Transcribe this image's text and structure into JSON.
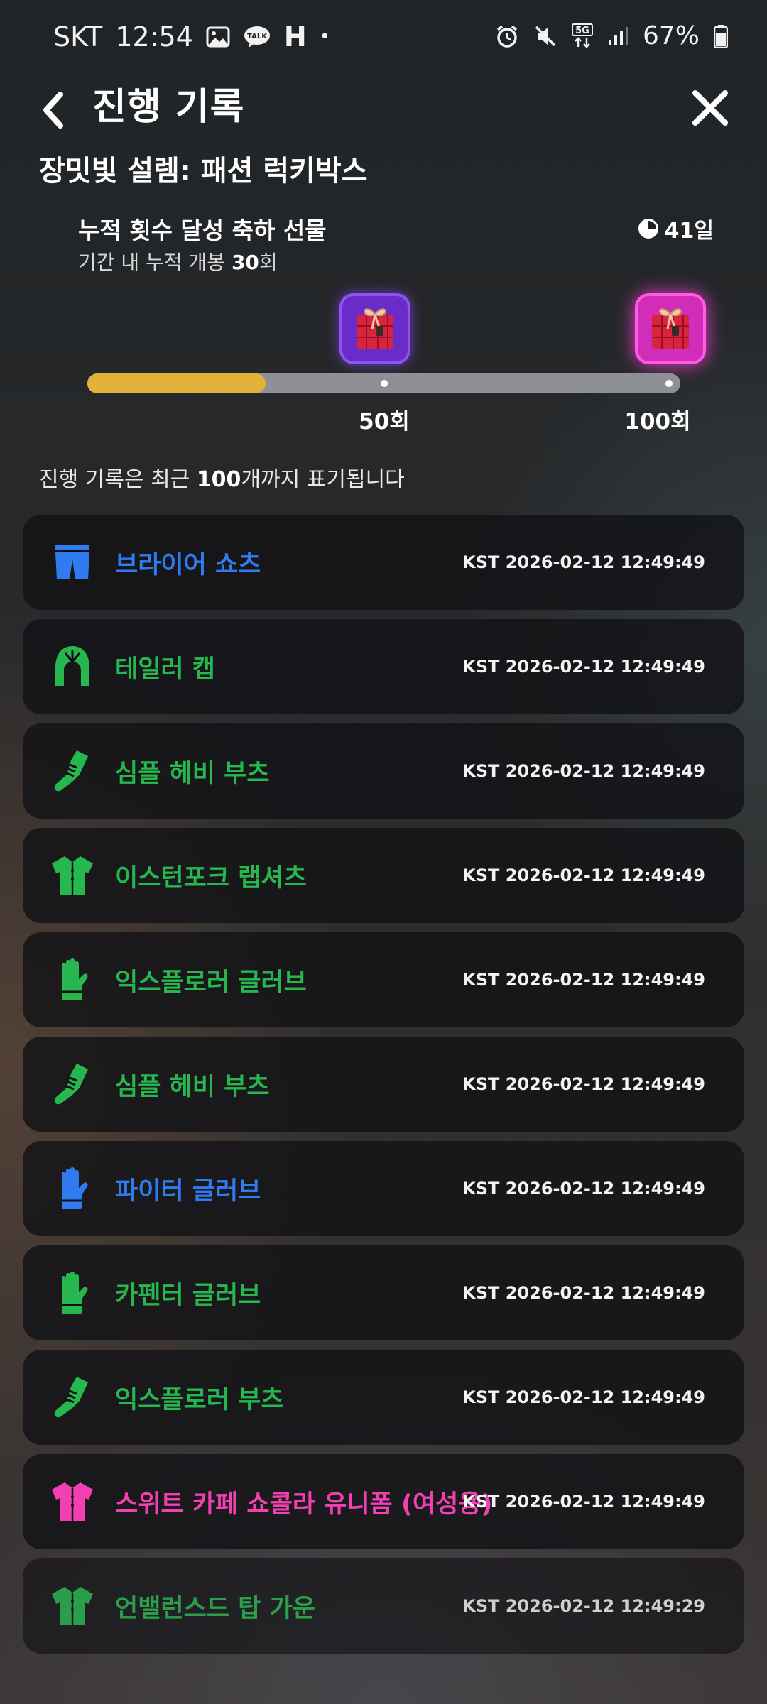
{
  "status": {
    "carrier": "SKT",
    "time": "12:54",
    "talk_badge": "TALK",
    "h_label": "H",
    "dot": "•",
    "network": "5G",
    "battery": "67%"
  },
  "header": {
    "title": "진행 기록"
  },
  "event": {
    "title": "장밋빛 설렘: 패션 럭키박스"
  },
  "reward": {
    "name": "누적 횟수 달성 축하 선물",
    "desc_prefix": "기간 내 누적 개봉 ",
    "desc_count": "30",
    "desc_suffix": "회",
    "days_left": "41일"
  },
  "progress": {
    "current": 30,
    "max": 100,
    "fill_fraction": 0.3,
    "milestones": [
      {
        "value": 50,
        "label": "50회"
      },
      {
        "value": 100,
        "label": "100회"
      }
    ]
  },
  "history_note": {
    "prefix": "진행 기록은 최근 ",
    "count": "100",
    "suffix": "개까지 표기됩니다"
  },
  "colors": {
    "blue": "#2f7cf0",
    "green": "#26b84f",
    "pink": "#f23fb2",
    "progress_fill": "#e2b23b"
  },
  "history": [
    {
      "name": "브라이어 쇼츠",
      "time": "KST 2026-02-12 12:49:49",
      "color": "#2f7cf0",
      "icon": "shorts-icon"
    },
    {
      "name": "테일러 캡",
      "time": "KST 2026-02-12 12:49:49",
      "color": "#26b84f",
      "icon": "cap-icon"
    },
    {
      "name": "심플 헤비 부츠",
      "time": "KST 2026-02-12 12:49:49",
      "color": "#26b84f",
      "icon": "boots-icon"
    },
    {
      "name": "이스턴포크 랩셔츠",
      "time": "KST 2026-02-12 12:49:49",
      "color": "#26b84f",
      "icon": "shirt-icon"
    },
    {
      "name": "익스플로러 글러브",
      "time": "KST 2026-02-12 12:49:49",
      "color": "#26b84f",
      "icon": "glove-icon"
    },
    {
      "name": "심플 헤비 부츠",
      "time": "KST 2026-02-12 12:49:49",
      "color": "#26b84f",
      "icon": "boots-icon"
    },
    {
      "name": "파이터 글러브",
      "time": "KST 2026-02-12 12:49:49",
      "color": "#2f7cf0",
      "icon": "glove-icon"
    },
    {
      "name": "카펜터 글러브",
      "time": "KST 2026-02-12 12:49:49",
      "color": "#26b84f",
      "icon": "glove-icon"
    },
    {
      "name": "익스플로러 부츠",
      "time": "KST 2026-02-12 12:49:49",
      "color": "#26b84f",
      "icon": "boots-icon"
    },
    {
      "name": "스위트 카페 쇼콜라 유니폼 (여성용)",
      "time": "KST 2026-02-12 12:49:49",
      "color": "#f23fb2",
      "icon": "shirt-icon"
    },
    {
      "name": "언밸런스드 탑 가운",
      "time": "KST 2026-02-12 12:49:29",
      "color": "#26b84f",
      "icon": "shirt-icon"
    }
  ]
}
